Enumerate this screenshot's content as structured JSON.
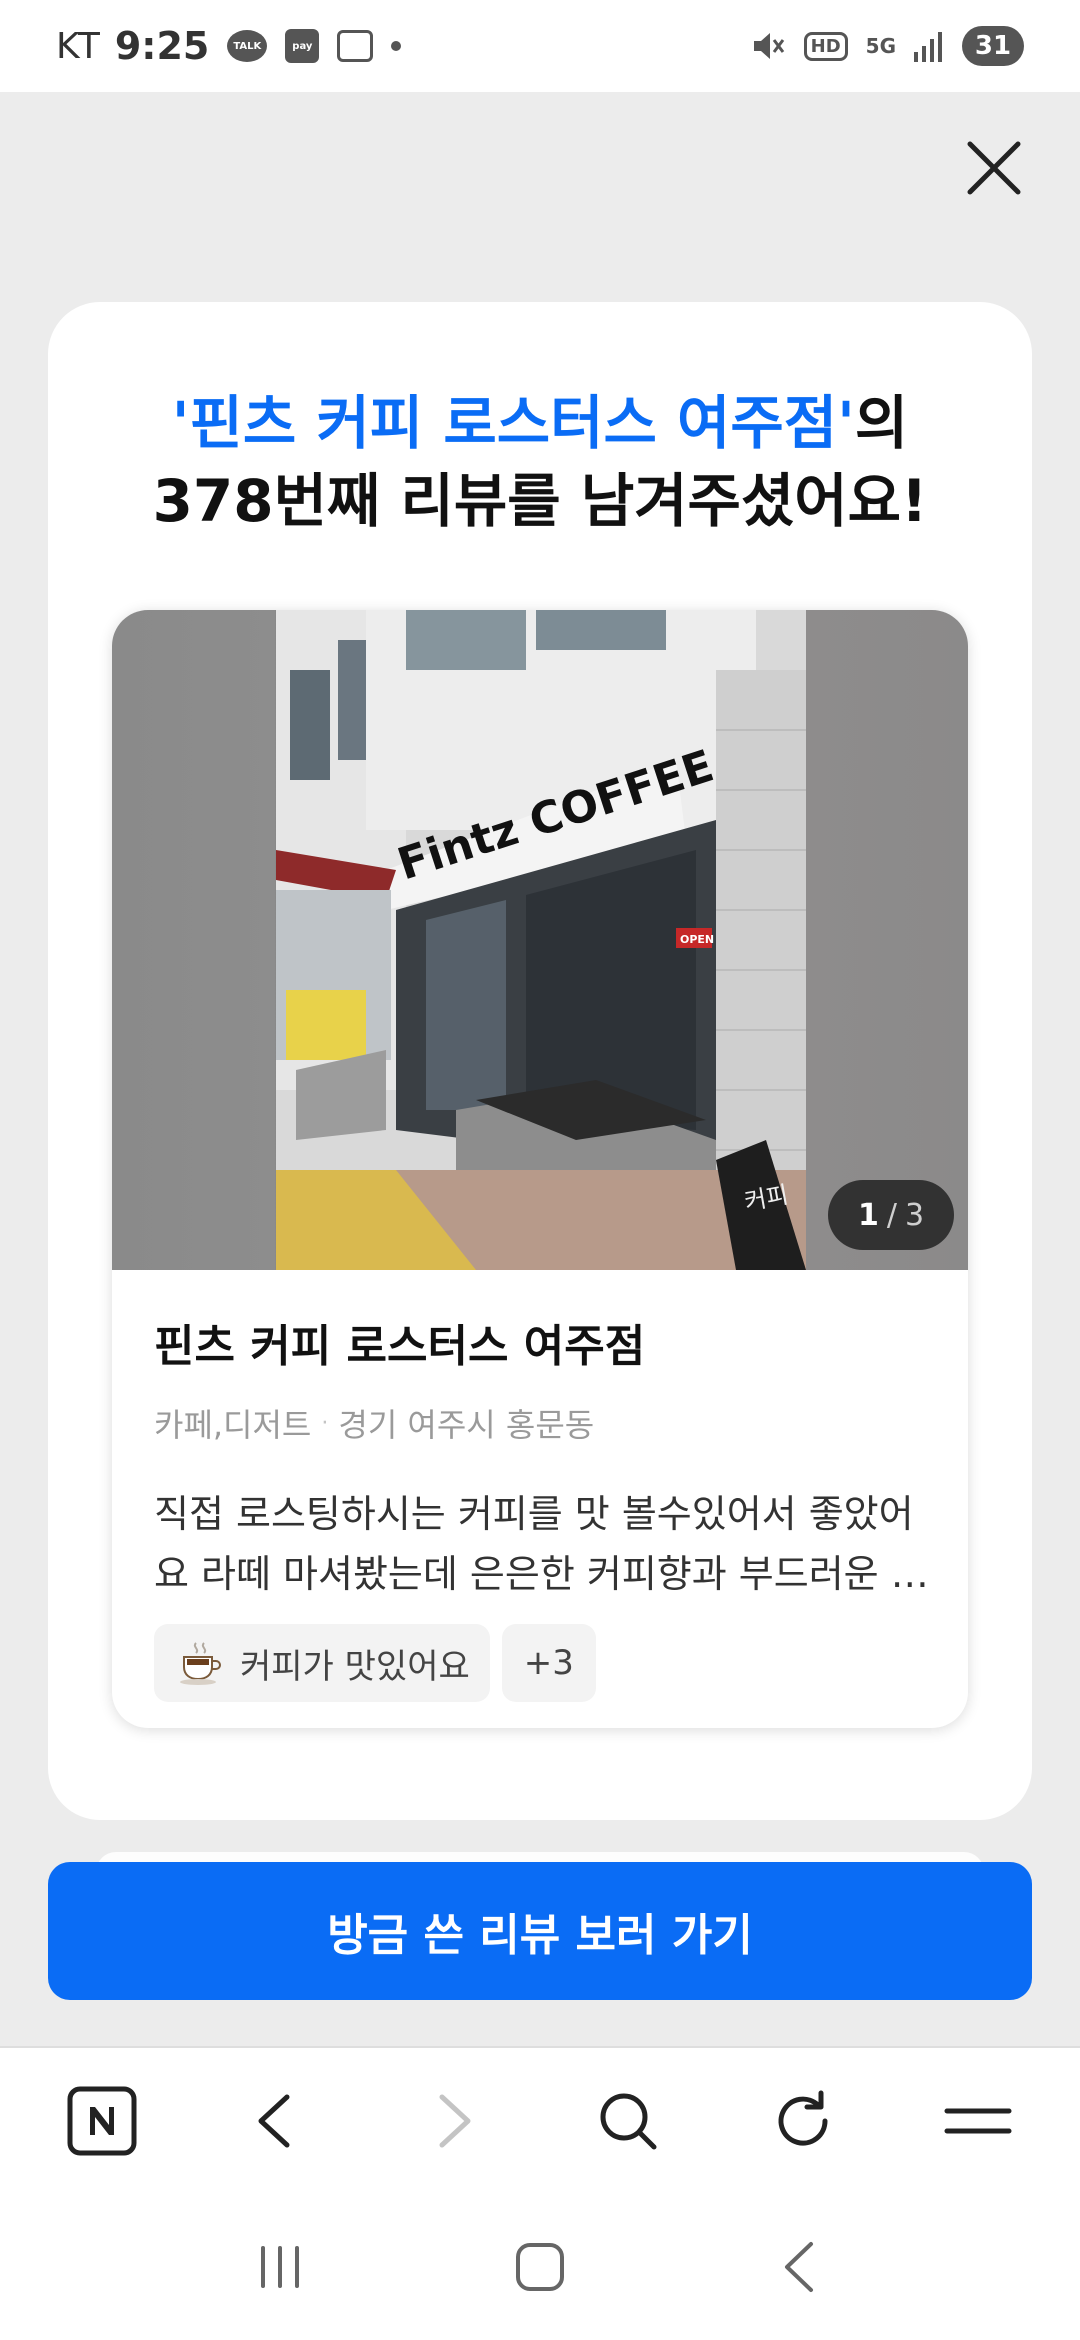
{
  "status_bar": {
    "carrier": "KT",
    "time": "9:25",
    "talk_badge": "TALK",
    "pay_badge": "pay",
    "hd_badge": "HD",
    "network": "5G",
    "battery": "31"
  },
  "modal": {
    "headline_highlight": "'핀츠 커피 로스터스 여주점'",
    "headline_suffix": "의",
    "headline_line2": "378번째 리뷰를 남겨주셨어요!",
    "card": {
      "photo_current": "1",
      "photo_separator": "/",
      "photo_total": "3",
      "sign_text": "Fintz COFFEE",
      "door_sign": "OPEN",
      "aframe_sign": "커피",
      "place_name": "핀츠 커피 로스터스 여주점",
      "category": "카페,디저트",
      "meta_separator": "·",
      "location": "경기 여주시 홍문동",
      "review_text": "직접 로스팅하시는 커피를 맛 볼수있어서 좋았어요 라떼 마셔봤는데 은은한 커피향과 부드러운 맛이 좋았어요",
      "keywords": [
        {
          "icon": "coffee-cup-icon",
          "label": "커피가 맛있어요"
        }
      ],
      "more_keywords": "+3"
    }
  },
  "cta": {
    "label": "방금 쓴 리뷰 보러 가기"
  },
  "toolbar": {
    "items": [
      "naver-home-icon",
      "back-arrow-icon",
      "forward-arrow-icon",
      "search-icon",
      "refresh-icon",
      "menu-icon"
    ]
  },
  "colors": {
    "accent": "#0a6cf5",
    "dim_background": "#ececec",
    "card_background": "#ffffff"
  }
}
